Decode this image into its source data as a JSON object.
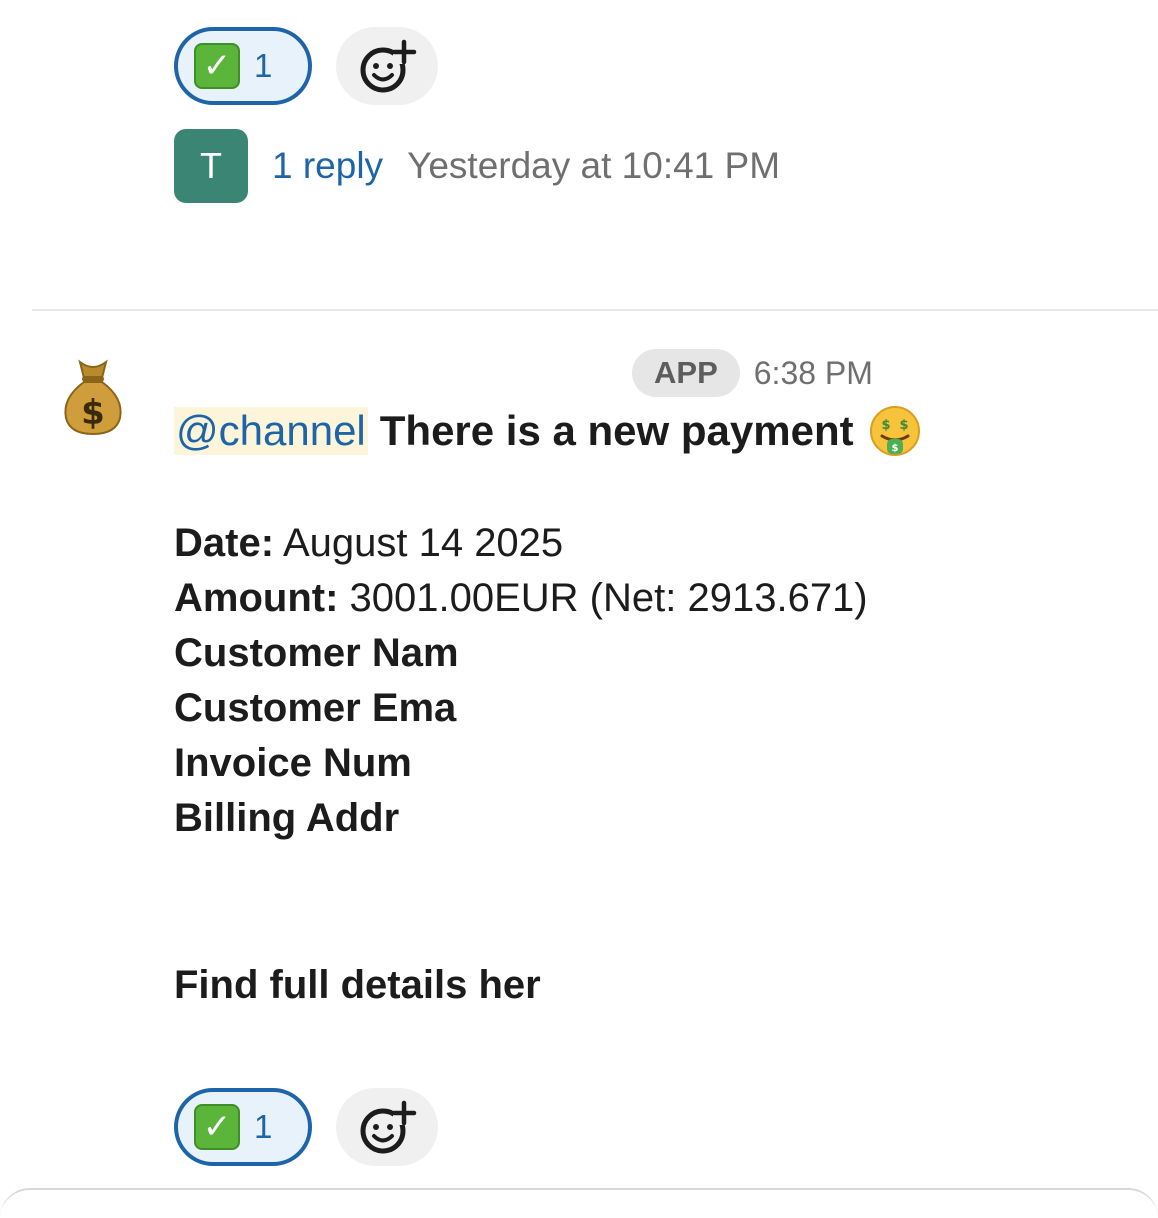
{
  "reactions_top": {
    "emoji_icon": "white-check-mark",
    "count": "1",
    "add_reaction_icon": "add-reaction-icon"
  },
  "thread": {
    "avatar_initial": "T",
    "reply_label": "1 reply",
    "timestamp": "Yesterday at 10:41 PM"
  },
  "message": {
    "avatar_icon": "money-bag-emoji",
    "badge": "APP",
    "time": "6:38 PM",
    "mention": "@channel",
    "headline": "There is a new payment",
    "headline_emoji": "money-mouth-face",
    "date_label": "Date:",
    "date_value": " August 14 2025",
    "amount_label": "Amount:",
    "amount_value": " 3001.00EUR (Net: 2913.671)",
    "customer_name_label": "Customer Nam",
    "customer_email_label": "Customer Ema",
    "invoice_label": "Invoice Num",
    "billing_label": "Billing Addr",
    "find_details": "Find full details her"
  },
  "reactions_bottom": {
    "emoji_icon": "white-check-mark",
    "count": "1",
    "add_reaction_icon": "add-reaction-icon"
  },
  "colors": {
    "link_blue": "#1d64a8",
    "avatar_green": "#3a8574",
    "mention_bg": "#fdf5da",
    "text": "#1d1c1d",
    "muted": "#6f6f6f"
  }
}
